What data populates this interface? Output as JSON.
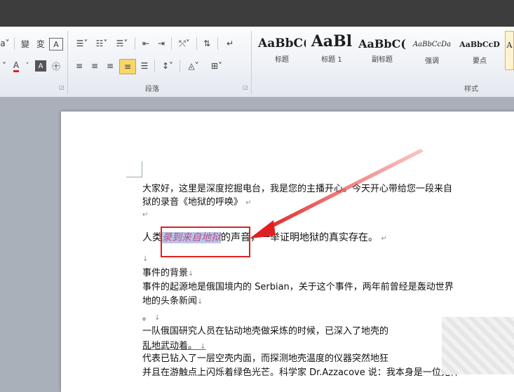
{
  "ribbon": {
    "paragraph_group_label": "段落",
    "styles_group_label": "样式",
    "font_buttons": [
      "a",
      "A",
      "A",
      "㊉",
      "变",
      "A"
    ],
    "styles": [
      {
        "sample": "AaBbC(",
        "label": "标题"
      },
      {
        "sample": "AaBl",
        "label": "标题 1"
      },
      {
        "sample": "AaBbC(",
        "label": "副标题"
      },
      {
        "sample": "AaBbCcDa",
        "label": "强调"
      },
      {
        "sample": "AaBbCcD",
        "label": "要点"
      },
      {
        "sample": "A",
        "label": ""
      }
    ]
  },
  "document": {
    "line1": "大家好，这里是深度挖掘电台，我是您的主播开心。今天开心带给您一段来自",
    "line2": "狱的录音《地狱的呼唤》",
    "line3_prefix": "人类",
    "line3_highlight": "录到来自地狱",
    "line3_suffix": "的声音，一举证明地狱的真实存在。",
    "line4": "事件的背景",
    "line5": "事件的起源地是俄国境内的 Serbian，关于这个事件，两年前曾经是轰动世界",
    "line6": "地的头条新闻",
    "line7": "。",
    "line8": "一队俄国研究人员在钻动地壳做采炼的时候，已深入了地壳的",
    "line9": "乱地武动着。",
    "line10": "代表已钻入了一层空壳内面，而探测地壳温度的仪器突然地狂",
    "line11": "并且在游触点上闪烁着绿色光芒。科学家 Dr.Azzacove 说：我本身是一位无神"
  },
  "colors": {
    "titlebar": "#3d3d3d",
    "highlight_bg": "#b7c7e6",
    "highlight_text": "#c04b86",
    "annotation_red": "#e02020"
  }
}
